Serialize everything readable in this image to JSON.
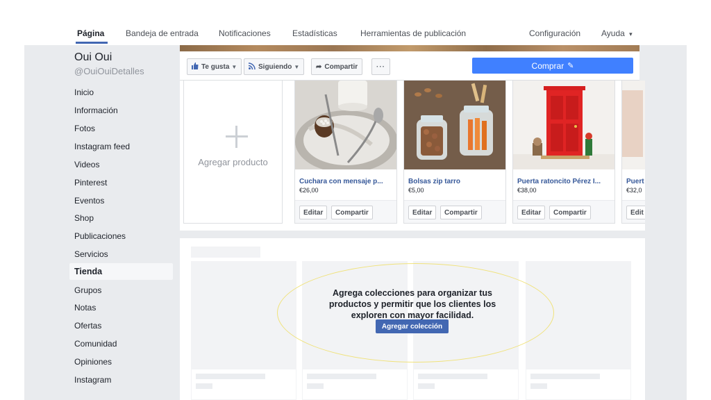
{
  "topnav": {
    "items": [
      "Página",
      "Bandeja de entrada",
      "Notificaciones",
      "Estadísticas",
      "Herramientas de publicación",
      "Configuración",
      "Ayuda"
    ],
    "help_caret": "▾"
  },
  "page": {
    "name": "Oui Oui",
    "handle": "@OuiOuiDetalles"
  },
  "sidebar": {
    "items": [
      "Inicio",
      "Información",
      "Fotos",
      "Instagram feed",
      "Videos",
      "Pinterest",
      "Eventos",
      "Shop",
      "Publicaciones",
      "Servicios",
      "Tienda",
      "Grupos",
      "Notas",
      "Ofertas",
      "Comunidad",
      "Opiniones",
      "Instagram"
    ],
    "active": "Tienda"
  },
  "actionbar": {
    "like": "Te gusta",
    "following": "Siguiendo",
    "share": "Compartir",
    "more": "···",
    "buy": "Comprar"
  },
  "icons": {
    "like": "thumbs-up-icon",
    "following": "rss-icon",
    "share": "share-arrow-icon",
    "buy": "pencil-icon"
  },
  "products": {
    "add_label": "Agregar producto",
    "edit_label": "Editar",
    "share_label": "Compartir",
    "items": [
      {
        "name": "Cuchara con mensaje p...",
        "price": "€26,00"
      },
      {
        "name": "Bolsas zip tarro",
        "price": "€5,00"
      },
      {
        "name": "Puerta ratoncito Pérez I...",
        "price": "€38,00"
      },
      {
        "name": "Puert",
        "price": "€32,0",
        "edit": "Edit"
      }
    ]
  },
  "collections": {
    "message": "Agrega colecciones para organizar tus productos y permitir que los clientes los exploren con mayor facilidad.",
    "button": "Agregar colección",
    "placeholder_price": "$"
  },
  "colors": {
    "accent": "#4267b2",
    "buy": "#4080ff",
    "link": "#365899",
    "highlight": "#f0e27a"
  }
}
